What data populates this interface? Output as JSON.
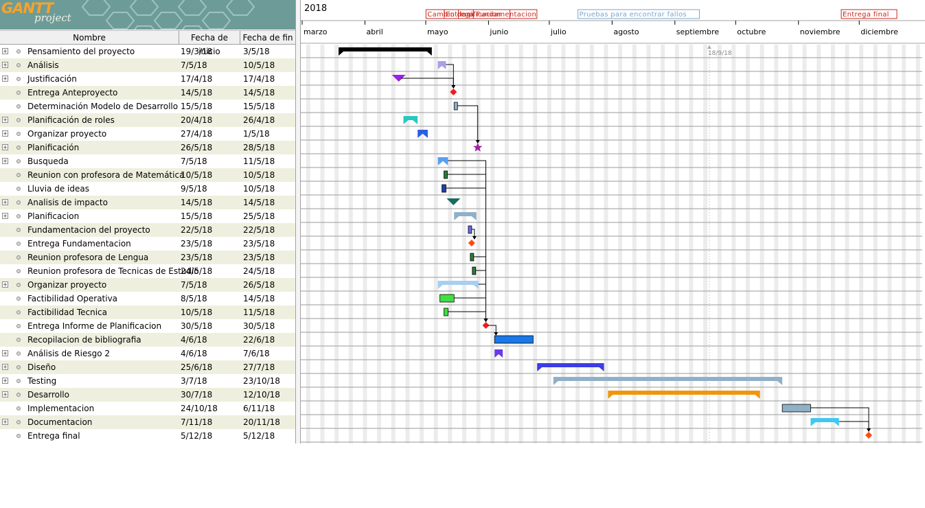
{
  "logo": {
    "main": "GANTT",
    "sub": "project"
  },
  "columns": {
    "name": "Nombre",
    "start": "Fecha de inicio",
    "end": "Fecha de fin"
  },
  "year": "2018",
  "months": [
    "marzo",
    "abril",
    "mayo",
    "junio",
    "julio",
    "agosto",
    "septiembre",
    "octubre",
    "noviembre",
    "diciembre"
  ],
  "today_marker": "18/9/18",
  "milestone_labels": [
    {
      "text": "Cambio de p",
      "color": "#c8261c"
    },
    {
      "text": "Entrega Fundamentacion",
      "color": "#c8261c"
    },
    {
      "text": "lanificacion",
      "color": "#c8261c"
    },
    {
      "text": "Pruebas para encontrar fallos",
      "color": "#7aa4c8"
    },
    {
      "text": "Entrega final",
      "color": "#c8261c"
    }
  ],
  "tasks": [
    {
      "name": "Pensamiento del proyecto",
      "start": "19/3/18",
      "end": "3/5/18",
      "expandable": true
    },
    {
      "name": "Análisis",
      "start": "7/5/18",
      "end": "10/5/18",
      "expandable": true
    },
    {
      "name": "Justificación",
      "start": "17/4/18",
      "end": "17/4/18",
      "expandable": true
    },
    {
      "name": "Entrega Anteproyecto",
      "start": "14/5/18",
      "end": "14/5/18",
      "expandable": false
    },
    {
      "name": "Determinación Modelo de Desarrollo",
      "start": "15/5/18",
      "end": "15/5/18",
      "expandable": false
    },
    {
      "name": "Planificación de roles",
      "start": "20/4/18",
      "end": "26/4/18",
      "expandable": true
    },
    {
      "name": "Organizar proyecto",
      "start": "27/4/18",
      "end": "1/5/18",
      "expandable": true
    },
    {
      "name": "Planificación",
      "start": "26/5/18",
      "end": "28/5/18",
      "expandable": true
    },
    {
      "name": "Busqueda",
      "start": "7/5/18",
      "end": "11/5/18",
      "expandable": true
    },
    {
      "name": "Reunion con profesora de Matemática",
      "start": "10/5/18",
      "end": "10/5/18",
      "expandable": false
    },
    {
      "name": "Lluvia de ideas",
      "start": "9/5/18",
      "end": "10/5/18",
      "expandable": false
    },
    {
      "name": "Analisis de impacto",
      "start": "14/5/18",
      "end": "14/5/18",
      "expandable": true
    },
    {
      "name": "Planificacion",
      "start": "15/5/18",
      "end": "25/5/18",
      "expandable": true
    },
    {
      "name": "Fundamentacion del proyecto",
      "start": "22/5/18",
      "end": "22/5/18",
      "expandable": false
    },
    {
      "name": "Entrega Fundamentacion",
      "start": "23/5/18",
      "end": "23/5/18",
      "expandable": false
    },
    {
      "name": "Reunion profesora de Lengua",
      "start": "23/5/18",
      "end": "23/5/18",
      "expandable": false
    },
    {
      "name": "Reunion profesora de Tecnicas de Estudio",
      "start": "24/5/18",
      "end": "24/5/18",
      "expandable": false
    },
    {
      "name": "Organizar proyecto",
      "start": "7/5/18",
      "end": "26/5/18",
      "expandable": true
    },
    {
      "name": "Factibilidad Operativa",
      "start": "8/5/18",
      "end": "14/5/18",
      "expandable": false
    },
    {
      "name": "Factibilidad Tecnica",
      "start": "10/5/18",
      "end": "11/5/18",
      "expandable": false
    },
    {
      "name": "Entrega Informe de Planificacion",
      "start": "30/5/18",
      "end": "30/5/18",
      "expandable": false
    },
    {
      "name": "Recopilacion de bibliografia",
      "start": "4/6/18",
      "end": "22/6/18",
      "expandable": false
    },
    {
      "name": "Análisis de Riesgo 2",
      "start": "4/6/18",
      "end": "7/6/18",
      "expandable": true
    },
    {
      "name": "Diseño",
      "start": "25/6/18",
      "end": "27/7/18",
      "expandable": true
    },
    {
      "name": "Testing",
      "start": "3/7/18",
      "end": "23/10/18",
      "expandable": true
    },
    {
      "name": "Desarrollo",
      "start": "30/7/18",
      "end": "12/10/18",
      "expandable": true
    },
    {
      "name": "Implementacion",
      "start": "24/10/18",
      "end": "6/11/18",
      "expandable": false
    },
    {
      "name": "Documentacion",
      "start": "7/11/18",
      "end": "20/11/18",
      "expandable": true
    },
    {
      "name": "Entrega final",
      "start": "5/12/18",
      "end": "5/12/18",
      "expandable": false
    }
  ],
  "bar_styles": [
    {
      "kind": "summary",
      "color": "#000000"
    },
    {
      "kind": "summary",
      "color": "#a9a0ea"
    },
    {
      "kind": "down",
      "color": "#9b1fe8"
    },
    {
      "kind": "milestone",
      "color": "#f01c1c"
    },
    {
      "kind": "bar",
      "color": "#8fb0c7"
    },
    {
      "kind": "summary",
      "color": "#28c8c0"
    },
    {
      "kind": "summary",
      "color": "#2a5fe0"
    },
    {
      "kind": "star",
      "color": "#a020a0"
    },
    {
      "kind": "summary",
      "color": "#5aa0f0"
    },
    {
      "kind": "bar",
      "color": "#2c7a3c"
    },
    {
      "kind": "bar",
      "color": "#1f3fb0"
    },
    {
      "kind": "down",
      "color": "#1a6a60"
    },
    {
      "kind": "summary",
      "color": "#8fb0c7"
    },
    {
      "kind": "bar",
      "color": "#6a6ae0"
    },
    {
      "kind": "milestone",
      "color": "#ff4a10"
    },
    {
      "kind": "bar",
      "color": "#2c7a3c"
    },
    {
      "kind": "bar",
      "color": "#2c7a3c"
    },
    {
      "kind": "summary",
      "color": "#a8cff0"
    },
    {
      "kind": "bar",
      "color": "#40e040"
    },
    {
      "kind": "bar",
      "color": "#40e040"
    },
    {
      "kind": "milestone",
      "color": "#f01c1c"
    },
    {
      "kind": "bar",
      "color": "#1a78e8"
    },
    {
      "kind": "summary",
      "color": "#6a3ae8"
    },
    {
      "kind": "summary",
      "color": "#3c3ce8"
    },
    {
      "kind": "summary",
      "color": "#8fb0c7"
    },
    {
      "kind": "summary",
      "color": "#f0960a"
    },
    {
      "kind": "bar",
      "color": "#8fb0c7"
    },
    {
      "kind": "summary",
      "color": "#40c8f0"
    },
    {
      "kind": "milestone",
      "color": "#ff4a10"
    }
  ]
}
